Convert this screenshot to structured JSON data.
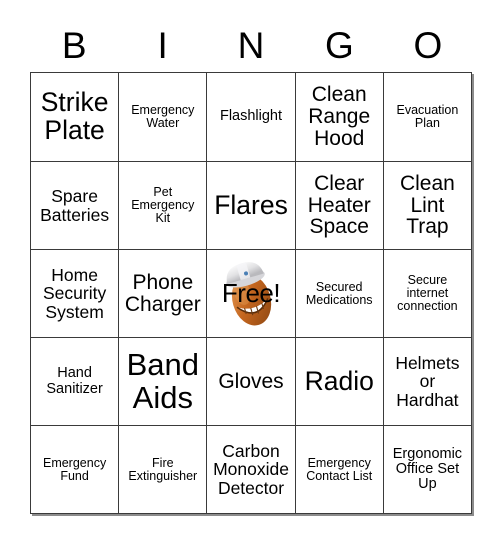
{
  "card": {
    "title": "BINGO Card",
    "header_letters": [
      "B",
      "I",
      "N",
      "G",
      "O"
    ],
    "colors": {
      "background": "#ffffff",
      "text": "#000000",
      "grid_line": "#3a3a3a",
      "shadow": "#8c8c8c",
      "mascot_body": "#c4661f",
      "mascot_body_light": "#e0working",
      "hardhat": "#f0f0f0"
    },
    "rows": [
      [
        {
          "label": "Strike Plate",
          "size": "xl",
          "free": false
        },
        {
          "label": "Emergency Water",
          "size": "xs",
          "free": false
        },
        {
          "label": "Flashlight",
          "size": "s",
          "free": false
        },
        {
          "label": "Clean Range Hood",
          "size": "l",
          "free": false
        },
        {
          "label": "Evacuation Plan",
          "size": "xs",
          "free": false
        }
      ],
      [
        {
          "label": "Spare Batteries",
          "size": "m",
          "free": false
        },
        {
          "label": "Pet Emergency Kit",
          "size": "xs",
          "free": false
        },
        {
          "label": "Flares",
          "size": "xl",
          "free": false
        },
        {
          "label": "Clear Heater Space",
          "size": "l",
          "free": false
        },
        {
          "label": "Clean Lint Trap",
          "size": "l",
          "free": false
        }
      ],
      [
        {
          "label": "Home Security System",
          "size": "m",
          "free": false
        },
        {
          "label": "Phone Charger",
          "size": "l",
          "free": false
        },
        {
          "label": "Free!",
          "size": "xl",
          "free": true
        },
        {
          "label": "Secured Medications",
          "size": "xs",
          "free": false
        },
        {
          "label": "Secure internet connection",
          "size": "xs",
          "free": false
        }
      ],
      [
        {
          "label": "Hand Sanitizer",
          "size": "s",
          "free": false
        },
        {
          "label": "Band Aids",
          "size": "xxl",
          "free": false
        },
        {
          "label": "Gloves",
          "size": "l",
          "free": false
        },
        {
          "label": "Radio",
          "size": "xl",
          "free": false
        },
        {
          "label": "Helmets or Hardhat",
          "size": "m",
          "free": false
        }
      ],
      [
        {
          "label": "Emergency Fund",
          "size": "xs",
          "free": false
        },
        {
          "label": "Fire Extinguisher",
          "size": "xs",
          "free": false
        },
        {
          "label": "Carbon Monoxide Detector",
          "size": "m",
          "free": false
        },
        {
          "label": "Emergency Contact List",
          "size": "xs",
          "free": false
        },
        {
          "label": "Ergonomic Office Set Up",
          "size": "s",
          "free": false
        }
      ]
    ],
    "free_space": {
      "label": "Free!",
      "icon": "hardhat-mascot-icon"
    }
  }
}
